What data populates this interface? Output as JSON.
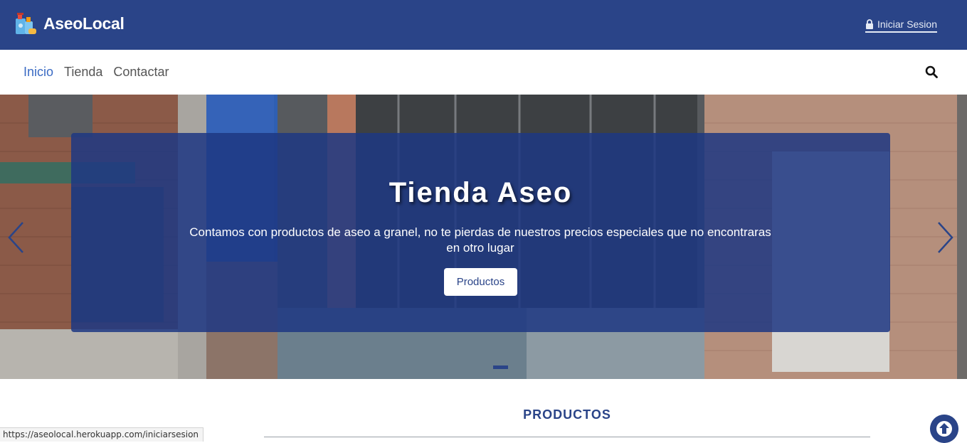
{
  "header": {
    "brand_name": "AseoLocal",
    "login_label": "Iniciar Sesion",
    "brand_color": "#2a4488"
  },
  "nav": {
    "items": [
      {
        "label": "Inicio",
        "active": true
      },
      {
        "label": "Tienda",
        "active": false
      },
      {
        "label": "Contactar",
        "active": false
      }
    ],
    "search_icon": "search-icon"
  },
  "hero": {
    "title": "Tienda Aseo",
    "text": "Contamos con productos de aseo a granel, no te pierdas de nuestros precios especiales que no encontraras en otro lugar",
    "button_label": "Productos",
    "prev_icon": "chevron-left-icon",
    "next_icon": "chevron-right-icon"
  },
  "products_section": {
    "title": "PRODUCTOS"
  },
  "status_bar": {
    "url": "https://aseolocal.herokuapp.com/iniciarsesion"
  }
}
